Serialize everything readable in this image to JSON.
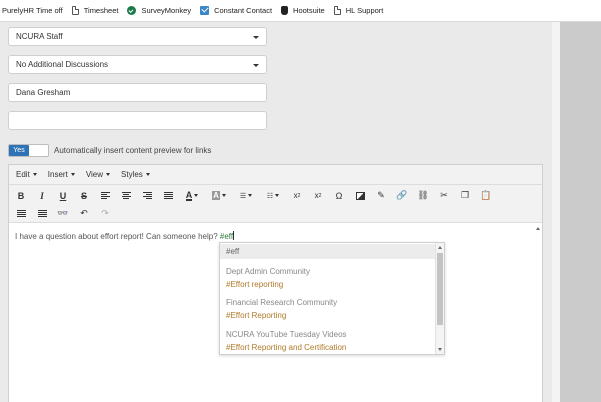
{
  "bookmarks": [
    {
      "label": "PurelyHR Time off",
      "icon": "none"
    },
    {
      "label": "Timesheet",
      "icon": "page-icon"
    },
    {
      "label": "SurveyMonkey",
      "icon": "surveymonkey-icon"
    },
    {
      "label": "Constant Contact",
      "icon": "constant-contact-icon"
    },
    {
      "label": "Hootsuite",
      "icon": "hootsuite-icon"
    },
    {
      "label": "HL Support",
      "icon": "page-icon"
    }
  ],
  "form": {
    "community_select": "NCURA Staff",
    "discussion_select": "No Additional Discussions",
    "author_field": "Dana Gresham",
    "empty_field": ""
  },
  "toggle": {
    "state_label": "Yes",
    "description": "Automatically insert content preview for links",
    "accent": "#2f72b5"
  },
  "editor": {
    "menus": [
      "Edit",
      "Insert",
      "View",
      "Styles"
    ],
    "content_text": "I have a question about effort report! Can someone help? ",
    "content_tag": "#eff"
  },
  "autocomplete": {
    "query": "#eff",
    "items": [
      {
        "community": "Dept Admin Community",
        "tag": "#Effort reporting"
      },
      {
        "community": "Financial Research Community",
        "tag": "#Effort Reporting"
      },
      {
        "community": "NCURA YouTube Tuesday Videos",
        "tag": "#Effort Reporting and Certification"
      }
    ]
  }
}
